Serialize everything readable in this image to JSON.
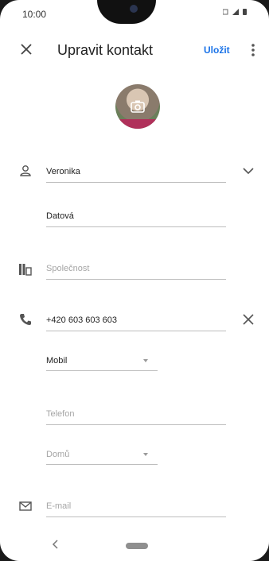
{
  "status": {
    "time": "10:00"
  },
  "header": {
    "title": "Upravit kontakt",
    "save_label": "Uložit"
  },
  "form": {
    "first_name": "Veronika",
    "last_name": "Datová",
    "company_placeholder": "Společnost",
    "phone": "+420 603 603 603",
    "phone_type": "Mobil",
    "phone2_placeholder": "Telefon",
    "phone2_type": "Domů",
    "email_placeholder": "E-mail"
  },
  "colors": {
    "accent": "#1a73e8",
    "text": "#222222",
    "placeholder": "#a5a5a5"
  },
  "icons": [
    "close-icon",
    "more-vert-icon",
    "camera-icon",
    "person-icon",
    "chevron-down-icon",
    "company-icon",
    "phone-icon",
    "clear-icon",
    "email-icon",
    "back-icon"
  ]
}
